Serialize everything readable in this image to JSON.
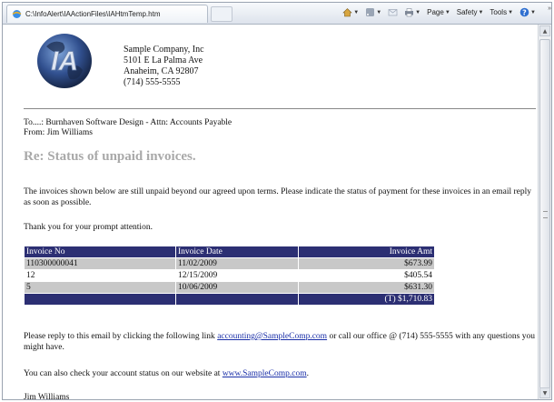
{
  "browser": {
    "tab_title": "C:\\InfoAlert\\IAActionFiles\\IAHtmTemp.htm",
    "commands": [
      {
        "label": "",
        "icon": "home-icon"
      },
      {
        "label": "",
        "icon": "feeds-icon"
      },
      {
        "label": "",
        "icon": "read-mail-icon"
      },
      {
        "label": "",
        "icon": "print-icon"
      },
      {
        "label": "Page",
        "icon": ""
      },
      {
        "label": "Safety",
        "icon": ""
      },
      {
        "label": "Tools",
        "icon": ""
      },
      {
        "label": "",
        "icon": "help-icon"
      }
    ],
    "more": "»"
  },
  "company": {
    "logo_text": "IA",
    "name": "Sample Company, Inc",
    "street": "5101 E La Palma Ave",
    "city": "Anaheim, CA 92807",
    "phone": "(714) 555-5555"
  },
  "email": {
    "to": "To....: Burnhaven Software Design - Attn: Accounts Payable",
    "from": "From: Jim Williams",
    "subject": "Re: Status of unpaid invoices.",
    "body": "The invoices shown below are still unpaid beyond our agreed upon terms. Please indicate the status of payment for these invoices in an email reply as soon as possible.",
    "thanks": "Thank you for your prompt attention.",
    "reply_prefix": "Please reply to this email by clicking the following link",
    "reply_link": "accounting@SampleComp.com",
    "reply_suffix": "or call our office @ (714) 555-5555 with any questions you might have.",
    "status_prefix": "You can also check your account status on our website at",
    "status_link": "www.SampleComp.com",
    "status_suffix": ".",
    "signature": "Jim Williams"
  },
  "invoices": {
    "headers": [
      "Invoice No",
      "Invoice Date",
      "Invoice Amt"
    ],
    "rows": [
      {
        "no": "110300000041",
        "date": "11/02/2009",
        "amt": "$673.99"
      },
      {
        "no": "12",
        "date": "12/15/2009",
        "amt": "$405.54"
      },
      {
        "no": "5",
        "date": "10/06/2009",
        "amt": "$631.30"
      }
    ],
    "total": "(T) $1,710.83"
  },
  "colors": {
    "table_header": "#2c2f73",
    "row_shade": "#c8c8c8",
    "subject": "#a9a9a9",
    "link": "#1a2fa8"
  }
}
